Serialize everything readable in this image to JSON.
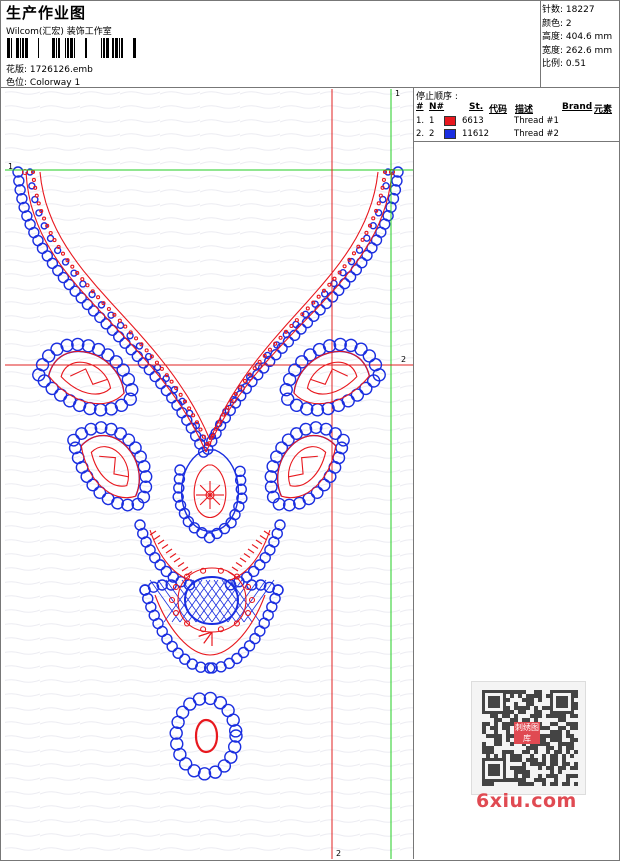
{
  "header": {
    "title": "生产作业图",
    "company": "Wilcom(汇宏) 装饰工作室",
    "design_label": "花版:",
    "design_value": "1726126.emb",
    "colorway_label": "色位:",
    "colorway_value": "Colorway 1"
  },
  "stats": {
    "stitches_label": "针数:",
    "stitches_value": "18227",
    "colors_label": "颜色:",
    "colors_value": "2",
    "height_label": "高度:",
    "height_value": "404.6 mm",
    "width_label": "宽度:",
    "width_value": "262.6 mm",
    "scale_label": "比例:",
    "scale_value": "0.51"
  },
  "stop_sequence": {
    "title": "停止顺序 :",
    "headers": {
      "num": "#",
      "n": "N#",
      "st": "St.",
      "code": "代码",
      "desc": "描述",
      "brand": "Brand",
      "element": "元素"
    },
    "rows": [
      {
        "num": "1.",
        "n": "1",
        "code": "6613",
        "desc": "Thread #1",
        "color": "#e8181e"
      },
      {
        "num": "2.",
        "n": "2",
        "code": "11612",
        "desc": "Thread #2",
        "color": "#1a2ee0"
      }
    ]
  },
  "guides": {
    "v1": "1",
    "h1": "1",
    "h2": "2",
    "v2": "2"
  },
  "colors": {
    "red_thread": "#e8181e",
    "blue_thread": "#1a2ee0",
    "green_guide": "#22cc22",
    "red_guide": "#e02020"
  },
  "watermark": {
    "text": "6xiu.com",
    "stamp": "刺绣图库"
  }
}
